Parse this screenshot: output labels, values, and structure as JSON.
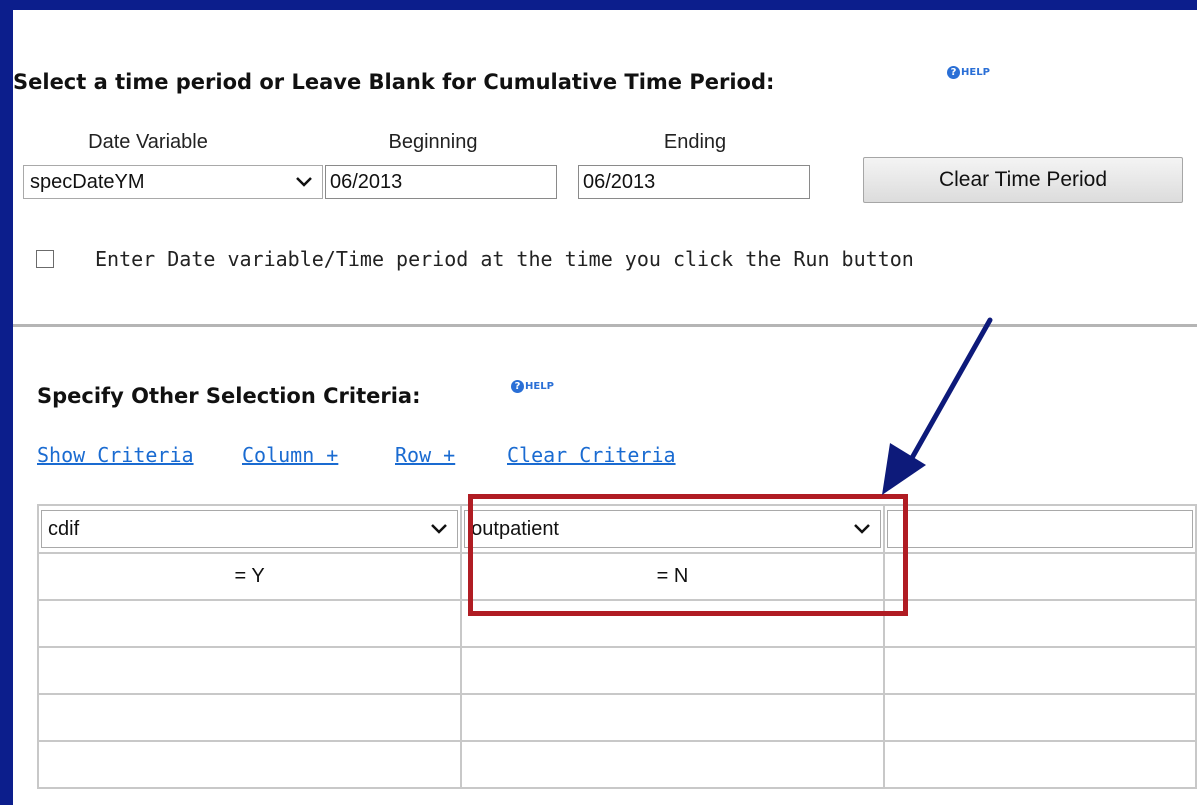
{
  "time_section": {
    "title": "Select a time period or Leave Blank for Cumulative Time Period:",
    "help_label": "HELP",
    "date_variable": {
      "label": "Date Variable",
      "value": "specDateYM"
    },
    "beginning": {
      "label": "Beginning",
      "value": "06/2013"
    },
    "ending": {
      "label": "Ending",
      "value": "06/2013"
    },
    "clear_button": "Clear Time Period",
    "checkbox_label": "Enter Date variable/Time period at the time you click the Run button",
    "checkbox_checked": false
  },
  "criteria_section": {
    "title": "Specify Other Selection Criteria:",
    "help_label": "HELP",
    "links": {
      "show_criteria": "Show Criteria",
      "column_plus": "Column +",
      "row_plus": "Row +",
      "clear_criteria": "Clear Criteria"
    },
    "grid": {
      "columns": [
        {
          "variable": "cdif",
          "value": "= Y"
        },
        {
          "variable": "outpatient",
          "value": "= N"
        },
        {
          "variable": "",
          "value": ""
        }
      ],
      "empty_rows": 4
    }
  },
  "annotation": {
    "highlight_color": "#b01c23",
    "arrow_color": "#0d1a7a"
  },
  "colors": {
    "frame": "#0c1e8c",
    "link": "#1a6bd1",
    "help": "#2a6fd6"
  }
}
